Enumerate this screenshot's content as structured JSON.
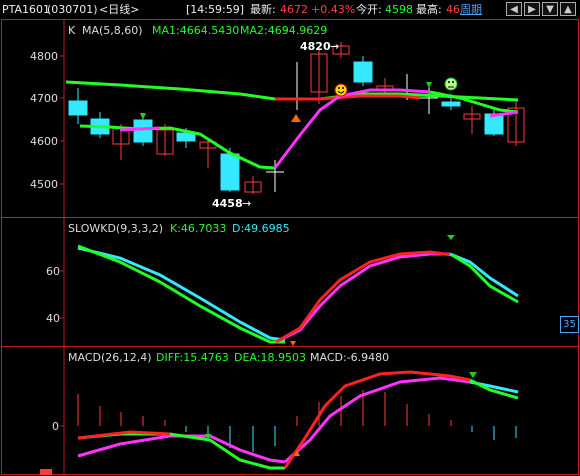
{
  "header": {
    "symbol": "PTA1601",
    "code": "(030701)",
    "period_tag": "<日线>",
    "time": "[14:59:59]",
    "latest_label": "最新:",
    "latest_value": "4672",
    "change": "+0.43%",
    "open_label": "今开:",
    "open_value": "4598",
    "high_label": "最高:",
    "high_value": "46",
    "period_button": "周期"
  },
  "main_panel": {
    "title_k": "K",
    "ma_label": "MA(5,8,60)",
    "ma1": "MA1:4664.5430",
    "ma2": "MA2:4694.9629",
    "y_ticks": [
      "4800",
      "4700",
      "4600",
      "4500"
    ],
    "high_marker": "4820",
    "low_marker": "4458"
  },
  "kd_panel": {
    "title": "SLOWKD(9,3,3,2)",
    "k": "K:46.7033",
    "d": "D:49.6985",
    "y_ticks": [
      "60",
      "40"
    ],
    "badge": "35"
  },
  "macd_panel": {
    "title": "MACD(26,12,4)",
    "diff": "DIFF:15.4763",
    "dea": "DEA:18.9503",
    "macd": "MACD:-6.9480",
    "y_ticks": [
      "0"
    ]
  },
  "colors": {
    "up": "#ff3b3b",
    "down": "#33e8ff",
    "ma_green": "#22ff22",
    "ma_magenta": "#ff33ff",
    "ma_red": "#ff2222",
    "frame": "#c02020",
    "yellow": "#ffff33"
  },
  "icons": {
    "nav_left": "left-arrow-icon",
    "nav_right": "right-arrow-icon",
    "nav_down": "down-arrow-icon",
    "nav_up": "up-arrow-icon",
    "happy_face": "smiley-icon",
    "neutral_face": "neutral-face-icon"
  }
}
